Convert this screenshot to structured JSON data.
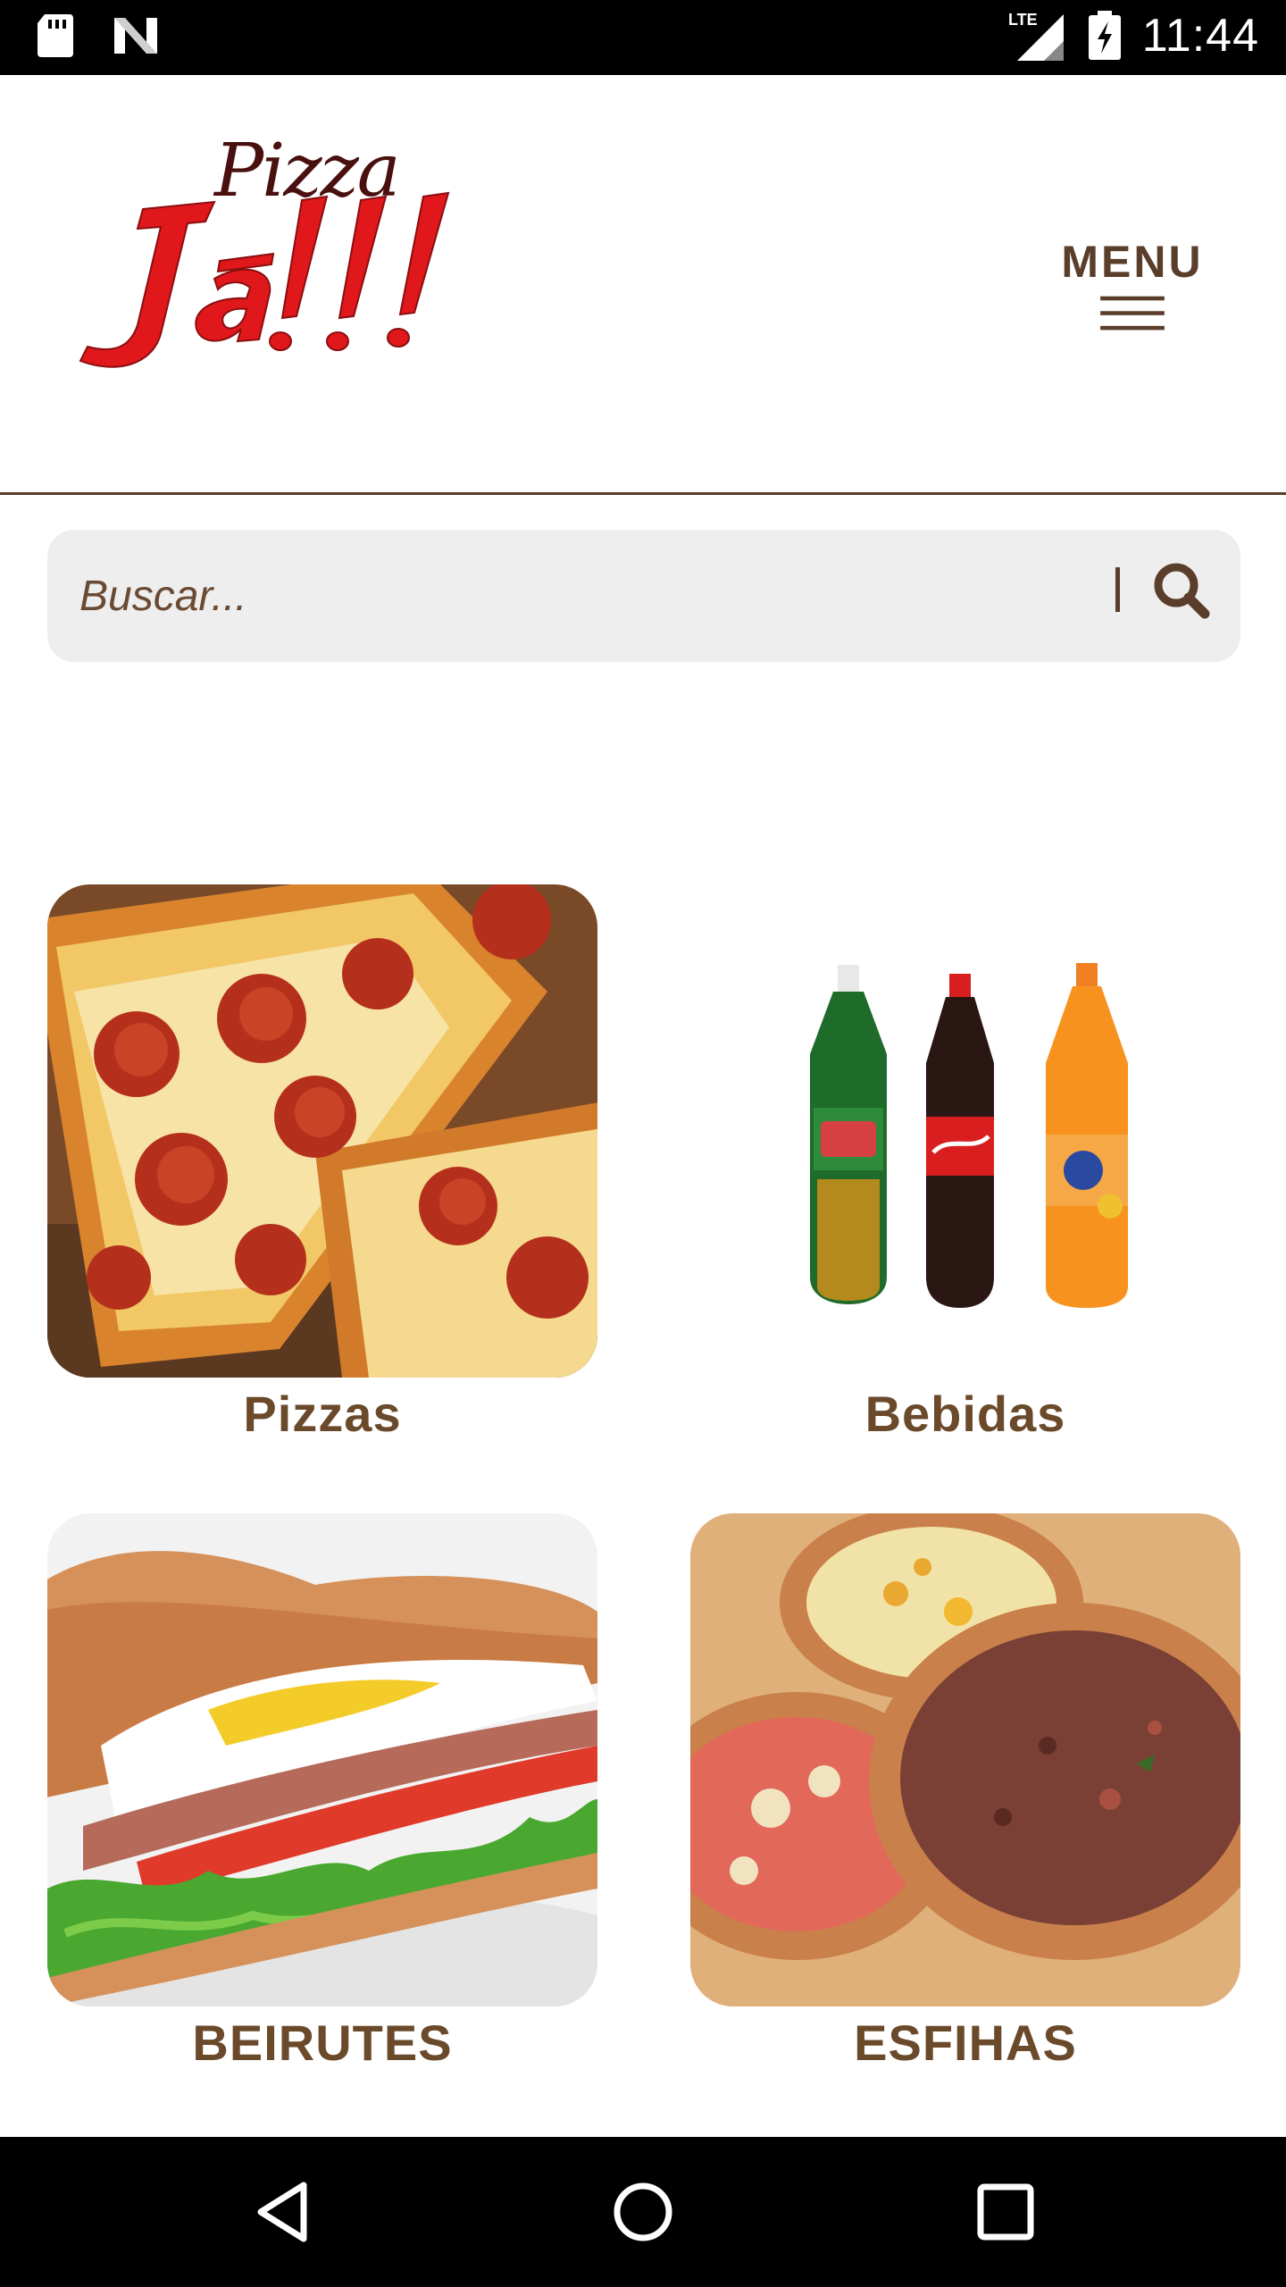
{
  "status_bar": {
    "time": "11:44",
    "network": "LTE",
    "icons": [
      "sd-card-icon",
      "n-notification-icon",
      "lte-signal-icon",
      "battery-charging-icon"
    ]
  },
  "header": {
    "logo_text_top": "Pizza",
    "logo_text_main": "Já!!!",
    "menu_label": "MENU"
  },
  "search": {
    "placeholder": "Buscar...",
    "value": ""
  },
  "categories": [
    {
      "label": "Pizzas",
      "image": "pizza-photo"
    },
    {
      "label": "Bebidas",
      "image": "drinks-photo"
    },
    {
      "label": "BEIRUTES",
      "image": "beirute-sandwich-photo"
    },
    {
      "label": "ESFIHAS",
      "image": "esfiha-photo"
    }
  ],
  "colors": {
    "brand_brown": "#5a3e2b",
    "label_brown": "#6b4a2b",
    "logo_red": "#e0181b",
    "search_bg": "#eeeeee"
  },
  "nav_bar": {
    "icons": [
      "back-icon",
      "home-icon",
      "recent-apps-icon"
    ]
  }
}
